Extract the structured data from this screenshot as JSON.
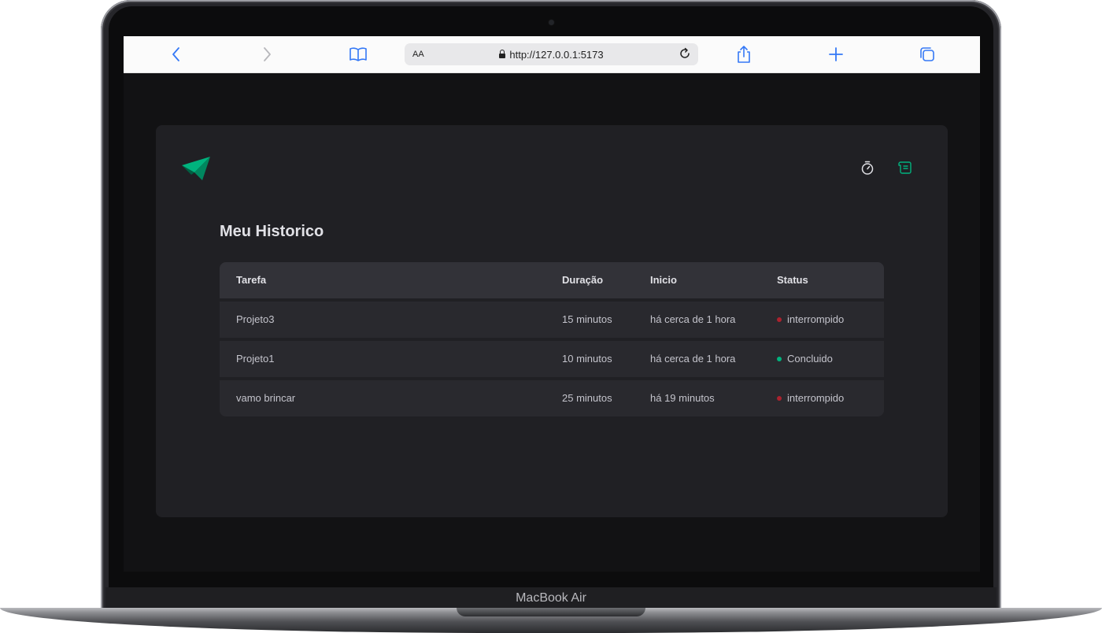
{
  "device": {
    "label": "MacBook Air"
  },
  "browser": {
    "address_size_label": "AA",
    "url": "http://127.0.0.1:5173"
  },
  "colors": {
    "brand": "#00875F",
    "brand_light": "#00B37E",
    "status_red": "#AB222E",
    "status_green": "#00B37E",
    "app_bg": "#202024",
    "screen_bg": "#121214"
  },
  "header": {
    "logo": "ignite-logo-icon",
    "nav": [
      {
        "icon": "timer-icon",
        "active": false
      },
      {
        "icon": "scroll-icon",
        "active": true
      }
    ]
  },
  "page": {
    "title": "Meu Historico"
  },
  "table": {
    "columns": [
      "Tarefa",
      "Duração",
      "Inicio",
      "Status"
    ],
    "rows": [
      {
        "task": "Projeto3",
        "duration": "15 minutos",
        "start": "há cerca de 1 hora",
        "status": "interrompido",
        "status_color": "#AB222E"
      },
      {
        "task": "Projeto1",
        "duration": "10 minutos",
        "start": "há cerca de 1 hora",
        "status": "Concluido",
        "status_color": "#00B37E"
      },
      {
        "task": "vamo brincar",
        "duration": "25 minutos",
        "start": "há 19 minutos",
        "status": "interrompido",
        "status_color": "#AB222E"
      }
    ]
  }
}
